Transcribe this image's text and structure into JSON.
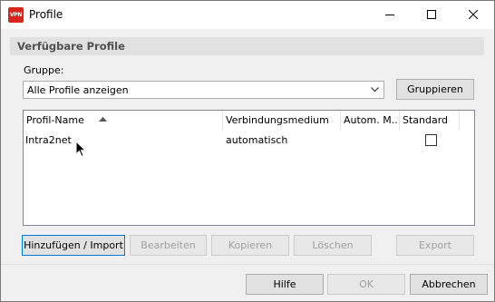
{
  "window": {
    "icon_text": "VPN",
    "title": "Profile"
  },
  "section": {
    "title": "Verfügbare Profile"
  },
  "group": {
    "label": "Gruppe:",
    "selected": "Alle Profile anzeigen",
    "group_button": "Gruppieren"
  },
  "list": {
    "columns": [
      "Profil-Name",
      "Verbindungsmedium",
      "Autom. M...",
      "Standard"
    ],
    "sort_column": "Profil-Name",
    "sort_direction": "ascending",
    "rows": [
      {
        "name": "Intra2net",
        "medium": "automatisch",
        "autom": "",
        "standard": false
      }
    ]
  },
  "actions": {
    "add": "Hinzufügen / Import",
    "edit": "Bearbeiten",
    "copy": "Kopieren",
    "delete": "Löschen",
    "export": "Export"
  },
  "footer": {
    "help": "Hilfe",
    "ok": "OK",
    "cancel": "Abbrechen"
  },
  "colors": {
    "accent": "#0078d7",
    "app_icon": "#d9261c",
    "section_bg": "#e1e1e1"
  }
}
